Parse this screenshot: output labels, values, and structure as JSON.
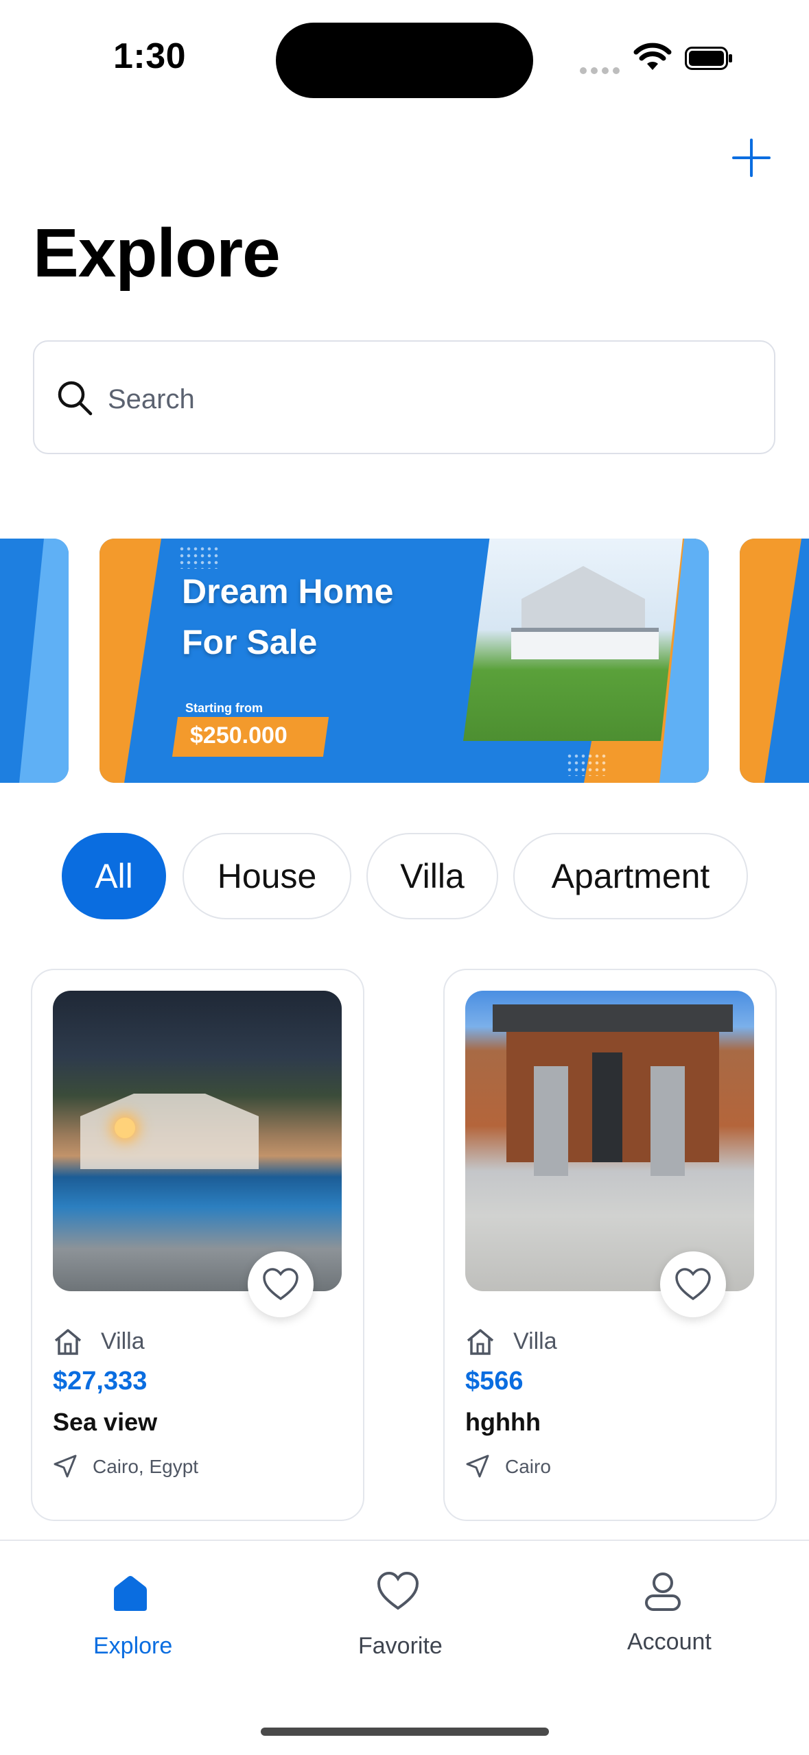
{
  "status_bar": {
    "time": "1:30"
  },
  "header": {
    "title": "Explore",
    "add_button_icon": "plus-icon"
  },
  "search": {
    "placeholder": "Search"
  },
  "banner": {
    "line1": "Dream Home",
    "line2": "For Sale",
    "starting_from": "Starting from",
    "price": "$250.000"
  },
  "filters": [
    {
      "label": "All",
      "active": true
    },
    {
      "label": "House",
      "active": false
    },
    {
      "label": "Villa",
      "active": false
    },
    {
      "label": "Apartment",
      "active": false
    }
  ],
  "listings": [
    {
      "type": "Villa",
      "price": "$27,333",
      "name": "Sea view",
      "location": "Cairo, Egypt"
    },
    {
      "type": "Villa",
      "price": "$566",
      "name": "hghhh",
      "location": "Cairo"
    }
  ],
  "tabbar": {
    "items": [
      {
        "label": "Explore",
        "icon": "home-icon",
        "active": true
      },
      {
        "label": "Favorite",
        "icon": "heart-icon",
        "active": false
      },
      {
        "label": "Account",
        "icon": "person-icon",
        "active": false
      }
    ]
  },
  "colors": {
    "accent": "#0a6de0",
    "banner_blue": "#1e7fe0",
    "banner_orange": "#f39a2c"
  }
}
